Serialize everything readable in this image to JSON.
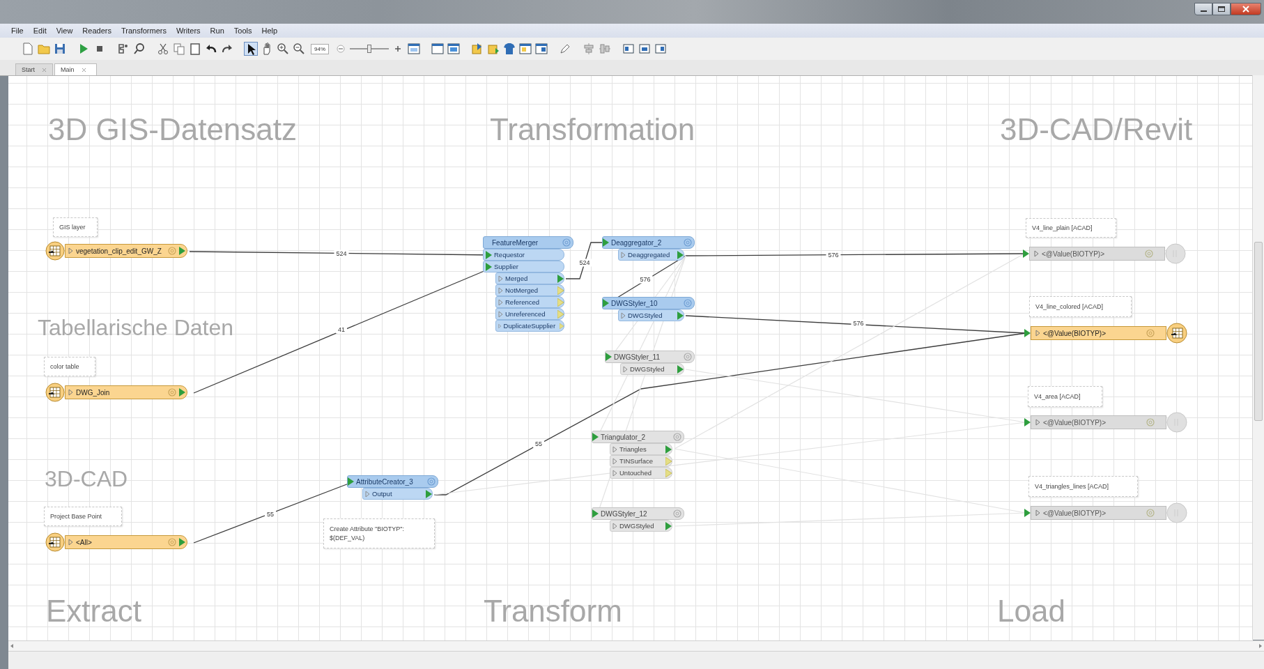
{
  "menu": [
    "File",
    "Edit",
    "View",
    "Readers",
    "Transformers",
    "Writers",
    "Run",
    "Tools",
    "Help"
  ],
  "toolbar": {
    "zoom_percent": "94%",
    "zoom_slider": {
      "level": 0.5
    }
  },
  "tabs": [
    {
      "label": "Start",
      "selected": false
    },
    {
      "label": "Main",
      "selected": true
    }
  ],
  "canvas": {
    "headings": [
      {
        "text": "3D GIS-Datensatz",
        "kind": "major"
      },
      {
        "text": "Transformation",
        "kind": "major"
      },
      {
        "text": "3D-CAD/Revit",
        "kind": "major"
      },
      {
        "text": "Tabellarische Daten",
        "kind": "minor"
      },
      {
        "text": "3D-CAD",
        "kind": "minor"
      },
      {
        "text": "Extract",
        "kind": "major"
      },
      {
        "text": "Transform",
        "kind": "major"
      },
      {
        "text": "Load",
        "kind": "major"
      }
    ],
    "annotations": [
      {
        "text": "GIS layer"
      },
      {
        "text": "color table"
      },
      {
        "text": "Project Base Point"
      },
      {
        "text": "Create Attribute \"BIOTYP\":\n$(DEF_VAL)"
      },
      {
        "text": "V4_line_plain [ACAD]"
      },
      {
        "text": "V4_line_colored [ACAD]"
      },
      {
        "text": "V4_area [ACAD]"
      },
      {
        "text": "V4_triangles_lines [ACAD]"
      }
    ],
    "readers": [
      {
        "name": "vegetation_clip_edit_GW_Z",
        "enabled": true
      },
      {
        "name": "DWG_Join",
        "enabled": true
      },
      {
        "name": "<All>",
        "enabled": true
      }
    ],
    "transformers": [
      {
        "name": "FeatureMerger",
        "enabled": true,
        "ports": [
          {
            "name": "Requestor",
            "kind": "input",
            "connected": true
          },
          {
            "name": "Supplier",
            "kind": "input",
            "connected": true
          },
          {
            "name": "Merged",
            "kind": "output",
            "connected": true
          },
          {
            "name": "NotMerged",
            "kind": "output",
            "connected": false
          },
          {
            "name": "Referenced",
            "kind": "output",
            "connected": false
          },
          {
            "name": "Unreferenced",
            "kind": "output",
            "connected": false
          },
          {
            "name": "DuplicateSupplier",
            "kind": "output",
            "connected": false
          }
        ]
      },
      {
        "name": "Deaggregator_2",
        "enabled": true,
        "ports": [
          {
            "name": "Deaggregated",
            "kind": "output",
            "connected": true
          }
        ]
      },
      {
        "name": "DWGStyler_10",
        "enabled": true,
        "ports": [
          {
            "name": "DWGStyled",
            "kind": "output",
            "connected": true
          }
        ]
      },
      {
        "name": "DWGStyler_11",
        "enabled": false,
        "ports": [
          {
            "name": "DWGStyled",
            "kind": "output",
            "connected": true
          }
        ]
      },
      {
        "name": "Triangulator_2",
        "enabled": false,
        "ports": [
          {
            "name": "Triangles",
            "kind": "output",
            "connected": true
          },
          {
            "name": "TINSurface",
            "kind": "output",
            "connected": false
          },
          {
            "name": "Untouched",
            "kind": "output",
            "connected": false
          }
        ]
      },
      {
        "name": "DWGStyler_12",
        "enabled": false,
        "ports": [
          {
            "name": "DWGStyled",
            "kind": "output",
            "connected": true
          }
        ]
      },
      {
        "name": "AttributeCreator_3",
        "enabled": true,
        "ports": [
          {
            "name": "Output",
            "kind": "output",
            "connected": true
          }
        ]
      }
    ],
    "writers": [
      {
        "name": "<@Value(BIOTYP)>",
        "enabled": false
      },
      {
        "name": "<@Value(BIOTYP)>",
        "enabled": true
      },
      {
        "name": "<@Value(BIOTYP)>",
        "enabled": false
      },
      {
        "name": "<@Value(BIOTYP)>",
        "enabled": false
      }
    ],
    "connections": [
      {
        "label": "524",
        "enabled": true
      },
      {
        "label": "41",
        "enabled": true
      },
      {
        "label": "55",
        "enabled": true
      },
      {
        "label": "524",
        "enabled": true
      },
      {
        "label": "576",
        "enabled": true
      },
      {
        "label": "576",
        "enabled": true
      },
      {
        "label": "576",
        "enabled": true
      },
      {
        "label": "55",
        "enabled": true
      },
      {
        "enabled": false
      },
      {
        "enabled": false
      },
      {
        "enabled": false
      },
      {
        "enabled": false
      },
      {
        "enabled": false
      },
      {
        "enabled": false
      },
      {
        "enabled": false
      },
      {
        "enabled": false
      }
    ]
  }
}
